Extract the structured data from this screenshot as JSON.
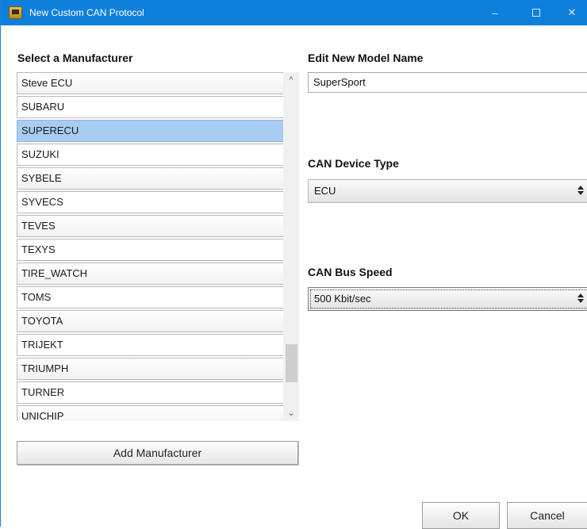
{
  "window": {
    "title": "New Custom CAN Protocol",
    "controls": {
      "minimize": "–",
      "maximize": "",
      "close": "✕"
    }
  },
  "manufacturer": {
    "label": "Select a Manufacturer",
    "items": [
      "Steve ECU",
      "SUBARU",
      "SUPERECU",
      "SUZUKI",
      "SYBELE",
      "SYVECS",
      "TEVES",
      "TEXYS",
      "TIRE_WATCH",
      "TOMS",
      "TOYOTA",
      "TRIJEKT",
      "TRIUMPH",
      "TURNER",
      "UNICHIP"
    ],
    "selected": "SUPERECU",
    "add_button": "Add Manufacturer"
  },
  "model": {
    "label": "Edit New Model Name",
    "value": "SuperSport"
  },
  "device_type": {
    "label": "CAN Device Type",
    "value": "ECU"
  },
  "bus_speed": {
    "label": "CAN Bus Speed",
    "value": "500 Kbit/sec"
  },
  "buttons": {
    "ok": "OK",
    "cancel": "Cancel"
  },
  "icons": {
    "app": "app-icon",
    "scroll_up": "chevron-up-icon",
    "scroll_down": "chevron-down-icon",
    "select_arrow": "updown-arrows-icon"
  },
  "colors": {
    "titlebar": "#0f7fdc",
    "selection": "#a8cdf0"
  }
}
